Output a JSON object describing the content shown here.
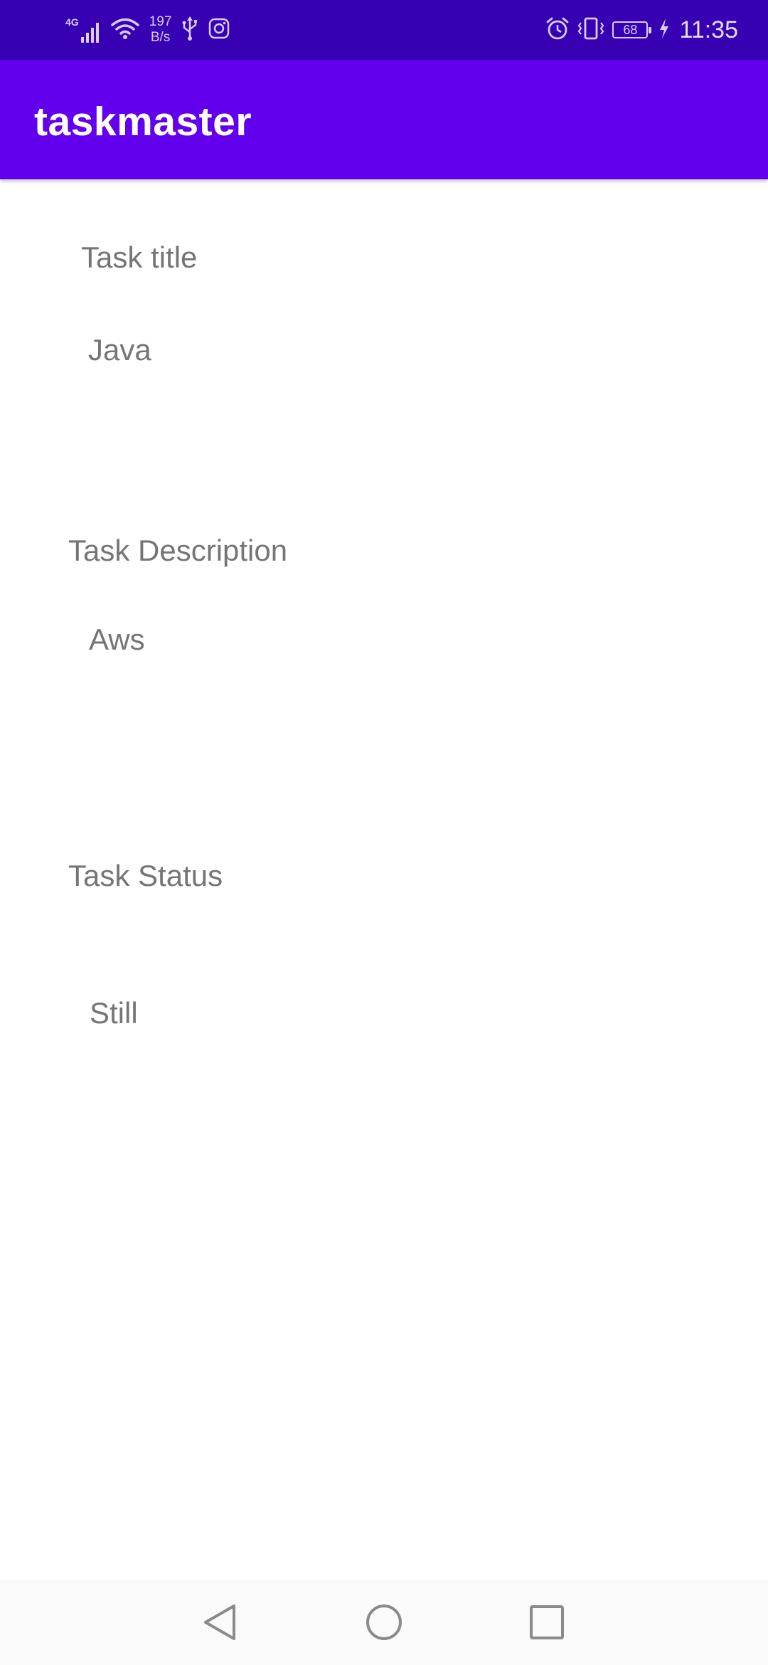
{
  "status_bar": {
    "network_label": "4G",
    "speed_value": "197",
    "speed_unit": "B/s",
    "battery_level": "68",
    "time": "11:35",
    "icons": [
      "signal-icon",
      "wifi-icon",
      "usb-icon",
      "instagram-icon",
      "alarm-icon",
      "vibrate-icon",
      "battery-icon",
      "charging-icon"
    ]
  },
  "app_bar": {
    "title": "taskmaster"
  },
  "task": {
    "title_label": "Task title",
    "title_value": "Java",
    "description_label": "Task Description",
    "description_value": "Aws",
    "status_label": "Task Status",
    "status_value": "Still"
  },
  "nav_bar": {
    "icons": [
      "back-icon",
      "home-icon",
      "recents-icon"
    ]
  },
  "colors": {
    "status_bar": "#3700b3",
    "app_bar": "#6200ee",
    "text": "#757575",
    "background": "#ffffff"
  }
}
